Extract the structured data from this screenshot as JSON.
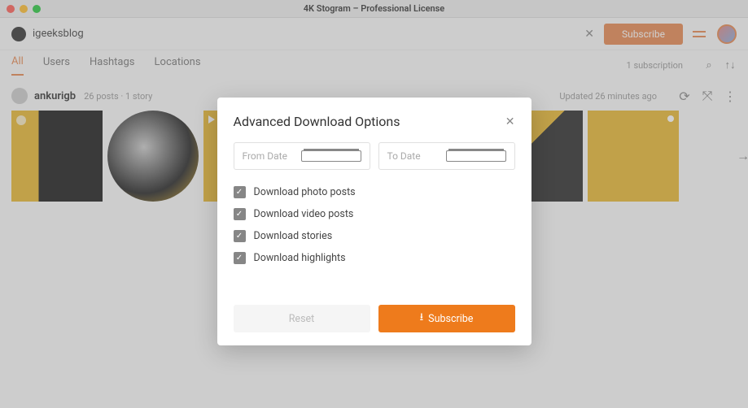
{
  "window": {
    "title": "4K Stogram – Professional License"
  },
  "search": {
    "value": "igeeksblog"
  },
  "topbar": {
    "subscribe_label": "Subscribe"
  },
  "tabs": {
    "items": [
      {
        "label": "All",
        "active": true
      },
      {
        "label": "Users",
        "active": false
      },
      {
        "label": "Hashtags",
        "active": false
      },
      {
        "label": "Locations",
        "active": false
      }
    ],
    "subscription_count": "1 subscription"
  },
  "user_row": {
    "username": "ankurigb",
    "meta": "26 posts  ·  1 story",
    "updated": "Updated 26 minutes ago"
  },
  "modal": {
    "title": "Advanced Download Options",
    "from_placeholder": "From Date",
    "to_placeholder": "To Date",
    "options": [
      {
        "label": "Download photo posts",
        "checked": true
      },
      {
        "label": "Download video posts",
        "checked": true
      },
      {
        "label": "Download stories",
        "checked": true
      },
      {
        "label": "Download highlights",
        "checked": true
      }
    ],
    "reset_label": "Reset",
    "subscribe_label": "Subscribe"
  }
}
